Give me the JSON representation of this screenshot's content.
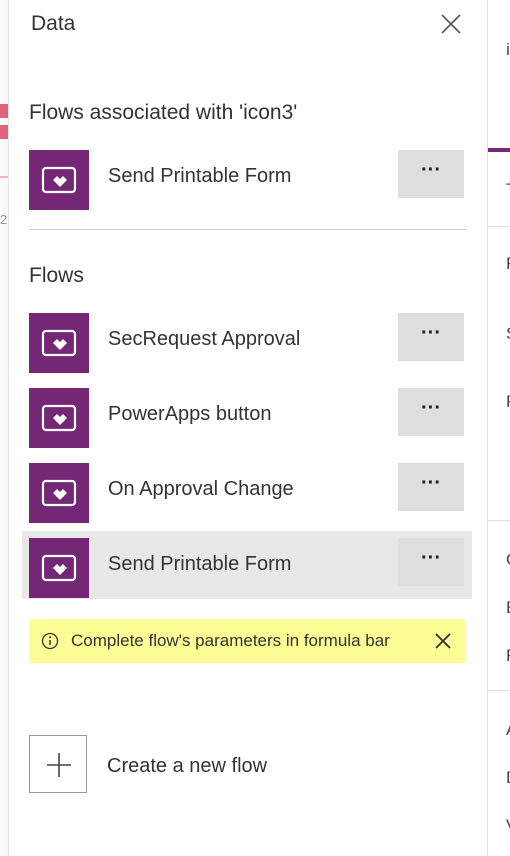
{
  "panel": {
    "title": "Data"
  },
  "associated": {
    "title": "Flows associated with 'icon3'",
    "items": [
      {
        "label": "Send Printable Form",
        "more": "···"
      }
    ]
  },
  "flows": {
    "title": "Flows",
    "items": [
      {
        "label": "SecRequest Approval",
        "more": "···"
      },
      {
        "label": "PowerApps button",
        "more": "···"
      },
      {
        "label": "On Approval Change",
        "more": "···"
      },
      {
        "label": "Send Printable Form",
        "more": "···",
        "selected": true
      }
    ]
  },
  "banner": {
    "text": "Complete flow's parameters in formula bar"
  },
  "create": {
    "label": "Create a new flow"
  },
  "left_strip": {
    "number": "2"
  },
  "right_panel": {
    "letters": [
      "i",
      "T",
      "F",
      "S",
      "F",
      "C",
      "E",
      "F",
      "A",
      "D",
      "V"
    ]
  },
  "colors": {
    "flow_icon_bg": "#742774",
    "banner_bg": "#fdfd96",
    "accent": "#742774"
  },
  "icons": {
    "close": "close-icon",
    "flow": "power-automate-flow-icon",
    "info": "info-icon",
    "plus": "plus-icon"
  }
}
